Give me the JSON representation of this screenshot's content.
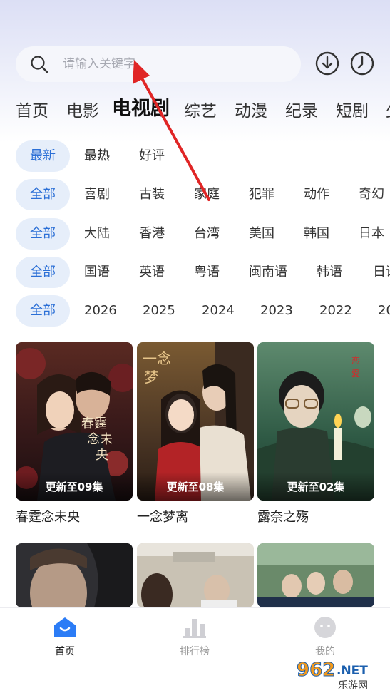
{
  "search": {
    "placeholder": "请输入关键字"
  },
  "header_icons": [
    "download-icon",
    "history-clock-icon"
  ],
  "category_tabs": [
    {
      "label": "首页",
      "active": false
    },
    {
      "label": "电影",
      "active": false
    },
    {
      "label": "电视剧",
      "active": true
    },
    {
      "label": "综艺",
      "active": false
    },
    {
      "label": "动漫",
      "active": false
    },
    {
      "label": "纪录",
      "active": false
    },
    {
      "label": "短剧",
      "active": false
    },
    {
      "label": "少",
      "active": false
    }
  ],
  "filters": {
    "sort": [
      "最新",
      "最热",
      "好评"
    ],
    "genre": [
      "全部",
      "喜剧",
      "古装",
      "家庭",
      "犯罪",
      "动作",
      "奇幻"
    ],
    "region": [
      "全部",
      "大陆",
      "香港",
      "台湾",
      "美国",
      "韩国",
      "日本"
    ],
    "language": [
      "全部",
      "国语",
      "英语",
      "粤语",
      "闽南语",
      "韩语",
      "日语"
    ],
    "year": [
      "全部",
      "2026",
      "2025",
      "2024",
      "2023",
      "2022",
      "20"
    ]
  },
  "cards": [
    {
      "title": "春霆念未央",
      "badge": "更新至09集"
    },
    {
      "title": "一念梦离",
      "badge": "更新至08集"
    },
    {
      "title": "露奈之殇",
      "badge": "更新至02集"
    }
  ],
  "bottom_nav": [
    {
      "label": "首页",
      "icon": "home-icon",
      "active": true
    },
    {
      "label": "排行榜",
      "icon": "ranking-icon",
      "active": false
    },
    {
      "label": "我的",
      "icon": "profile-icon",
      "active": false
    }
  ],
  "colors": {
    "accent": "#2b6fd6",
    "chip_bg": "#e6eefa",
    "nav_active": "#2b7cf6",
    "annotation_arrow": "#e02525"
  },
  "watermark": "962.NET 乐游网"
}
